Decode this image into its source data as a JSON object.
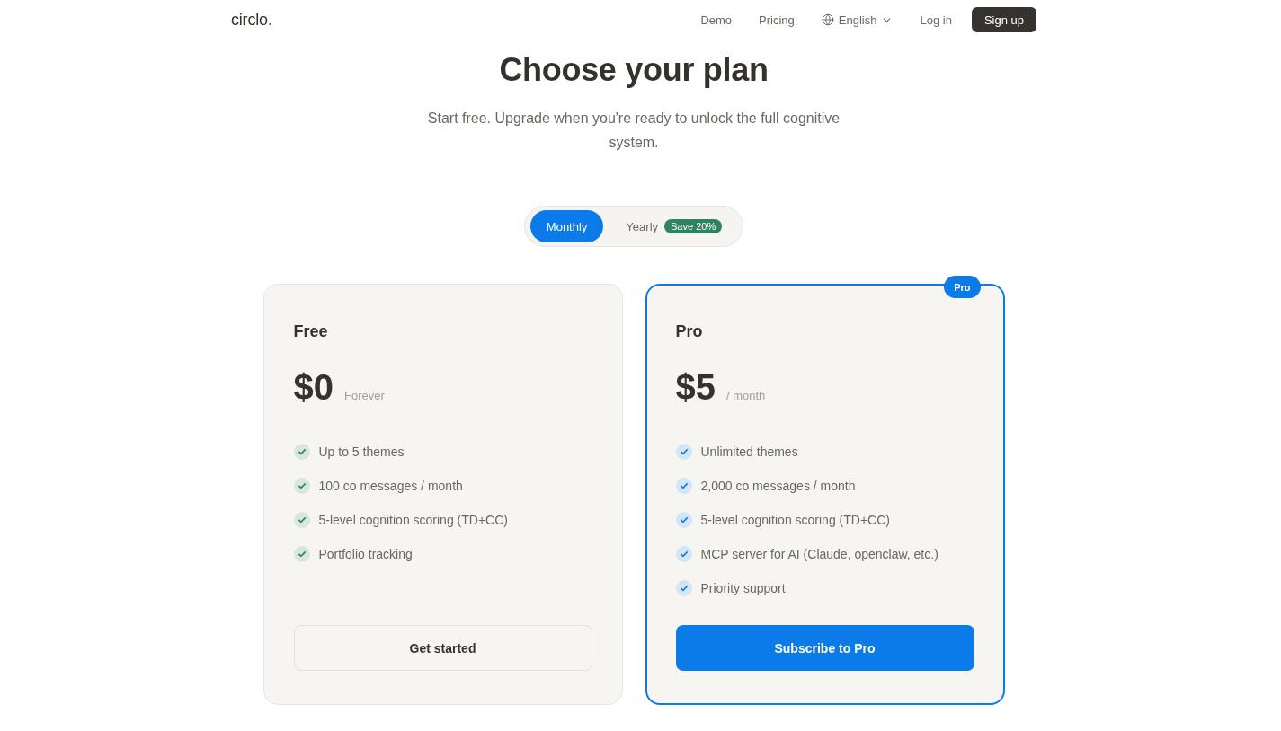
{
  "nav": {
    "logo": {
      "word": "circlo",
      "mark": "."
    },
    "links": [
      {
        "label": "Demo"
      },
      {
        "label": "Pricing"
      }
    ],
    "language": {
      "label": "English"
    },
    "login": "Log in",
    "signup": "Sign up"
  },
  "hero": {
    "title": "Choose your plan",
    "subtitle": "Start free. Upgrade when you're ready to unlock the full cognitive system."
  },
  "billing_toggle": [
    {
      "label": "Monthly",
      "selected": true
    },
    {
      "label": "Yearly",
      "selected": false,
      "badge": "Save 20%"
    }
  ],
  "plans": [
    {
      "name": "Free",
      "price": "$0",
      "period": "Forever",
      "highlighted": false,
      "features": [
        "Up to 5 themes",
        "100 co messages / month",
        "5-level cognition scoring (TD+CC)",
        "Portfolio tracking"
      ],
      "button": "Get started"
    },
    {
      "name": "Pro",
      "badge": "Pro",
      "price": "$5",
      "period": "/ month",
      "highlighted": true,
      "features": [
        "Unlimited themes",
        "2,000 co messages / month",
        "5-level cognition scoring (TD+CC)",
        "MCP server for AI (Claude, openclaw, etc.)",
        "Priority support"
      ],
      "button": "Subscribe to Pro"
    }
  ]
}
